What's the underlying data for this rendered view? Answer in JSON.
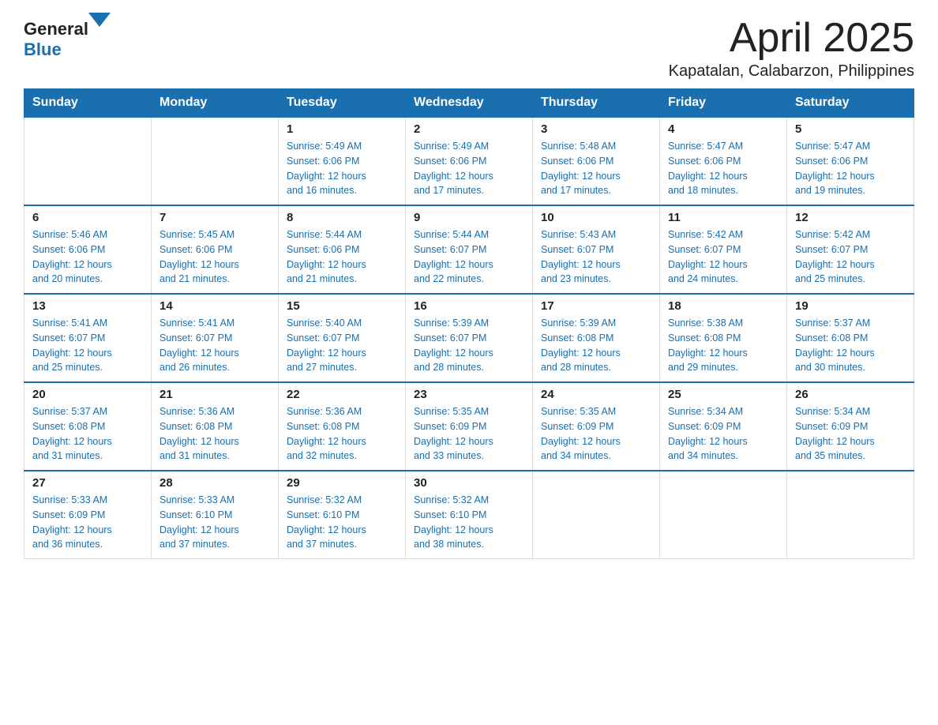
{
  "header": {
    "logo_general": "General",
    "logo_blue": "Blue",
    "month_title": "April 2025",
    "subtitle": "Kapatalan, Calabarzon, Philippines"
  },
  "days_of_week": [
    "Sunday",
    "Monday",
    "Tuesday",
    "Wednesday",
    "Thursday",
    "Friday",
    "Saturday"
  ],
  "weeks": [
    [
      {
        "day": "",
        "info": ""
      },
      {
        "day": "",
        "info": ""
      },
      {
        "day": "1",
        "info": "Sunrise: 5:49 AM\nSunset: 6:06 PM\nDaylight: 12 hours\nand 16 minutes."
      },
      {
        "day": "2",
        "info": "Sunrise: 5:49 AM\nSunset: 6:06 PM\nDaylight: 12 hours\nand 17 minutes."
      },
      {
        "day": "3",
        "info": "Sunrise: 5:48 AM\nSunset: 6:06 PM\nDaylight: 12 hours\nand 17 minutes."
      },
      {
        "day": "4",
        "info": "Sunrise: 5:47 AM\nSunset: 6:06 PM\nDaylight: 12 hours\nand 18 minutes."
      },
      {
        "day": "5",
        "info": "Sunrise: 5:47 AM\nSunset: 6:06 PM\nDaylight: 12 hours\nand 19 minutes."
      }
    ],
    [
      {
        "day": "6",
        "info": "Sunrise: 5:46 AM\nSunset: 6:06 PM\nDaylight: 12 hours\nand 20 minutes."
      },
      {
        "day": "7",
        "info": "Sunrise: 5:45 AM\nSunset: 6:06 PM\nDaylight: 12 hours\nand 21 minutes."
      },
      {
        "day": "8",
        "info": "Sunrise: 5:44 AM\nSunset: 6:06 PM\nDaylight: 12 hours\nand 21 minutes."
      },
      {
        "day": "9",
        "info": "Sunrise: 5:44 AM\nSunset: 6:07 PM\nDaylight: 12 hours\nand 22 minutes."
      },
      {
        "day": "10",
        "info": "Sunrise: 5:43 AM\nSunset: 6:07 PM\nDaylight: 12 hours\nand 23 minutes."
      },
      {
        "day": "11",
        "info": "Sunrise: 5:42 AM\nSunset: 6:07 PM\nDaylight: 12 hours\nand 24 minutes."
      },
      {
        "day": "12",
        "info": "Sunrise: 5:42 AM\nSunset: 6:07 PM\nDaylight: 12 hours\nand 25 minutes."
      }
    ],
    [
      {
        "day": "13",
        "info": "Sunrise: 5:41 AM\nSunset: 6:07 PM\nDaylight: 12 hours\nand 25 minutes."
      },
      {
        "day": "14",
        "info": "Sunrise: 5:41 AM\nSunset: 6:07 PM\nDaylight: 12 hours\nand 26 minutes."
      },
      {
        "day": "15",
        "info": "Sunrise: 5:40 AM\nSunset: 6:07 PM\nDaylight: 12 hours\nand 27 minutes."
      },
      {
        "day": "16",
        "info": "Sunrise: 5:39 AM\nSunset: 6:07 PM\nDaylight: 12 hours\nand 28 minutes."
      },
      {
        "day": "17",
        "info": "Sunrise: 5:39 AM\nSunset: 6:08 PM\nDaylight: 12 hours\nand 28 minutes."
      },
      {
        "day": "18",
        "info": "Sunrise: 5:38 AM\nSunset: 6:08 PM\nDaylight: 12 hours\nand 29 minutes."
      },
      {
        "day": "19",
        "info": "Sunrise: 5:37 AM\nSunset: 6:08 PM\nDaylight: 12 hours\nand 30 minutes."
      }
    ],
    [
      {
        "day": "20",
        "info": "Sunrise: 5:37 AM\nSunset: 6:08 PM\nDaylight: 12 hours\nand 31 minutes."
      },
      {
        "day": "21",
        "info": "Sunrise: 5:36 AM\nSunset: 6:08 PM\nDaylight: 12 hours\nand 31 minutes."
      },
      {
        "day": "22",
        "info": "Sunrise: 5:36 AM\nSunset: 6:08 PM\nDaylight: 12 hours\nand 32 minutes."
      },
      {
        "day": "23",
        "info": "Sunrise: 5:35 AM\nSunset: 6:09 PM\nDaylight: 12 hours\nand 33 minutes."
      },
      {
        "day": "24",
        "info": "Sunrise: 5:35 AM\nSunset: 6:09 PM\nDaylight: 12 hours\nand 34 minutes."
      },
      {
        "day": "25",
        "info": "Sunrise: 5:34 AM\nSunset: 6:09 PM\nDaylight: 12 hours\nand 34 minutes."
      },
      {
        "day": "26",
        "info": "Sunrise: 5:34 AM\nSunset: 6:09 PM\nDaylight: 12 hours\nand 35 minutes."
      }
    ],
    [
      {
        "day": "27",
        "info": "Sunrise: 5:33 AM\nSunset: 6:09 PM\nDaylight: 12 hours\nand 36 minutes."
      },
      {
        "day": "28",
        "info": "Sunrise: 5:33 AM\nSunset: 6:10 PM\nDaylight: 12 hours\nand 37 minutes."
      },
      {
        "day": "29",
        "info": "Sunrise: 5:32 AM\nSunset: 6:10 PM\nDaylight: 12 hours\nand 37 minutes."
      },
      {
        "day": "30",
        "info": "Sunrise: 5:32 AM\nSunset: 6:10 PM\nDaylight: 12 hours\nand 38 minutes."
      },
      {
        "day": "",
        "info": ""
      },
      {
        "day": "",
        "info": ""
      },
      {
        "day": "",
        "info": ""
      }
    ]
  ]
}
